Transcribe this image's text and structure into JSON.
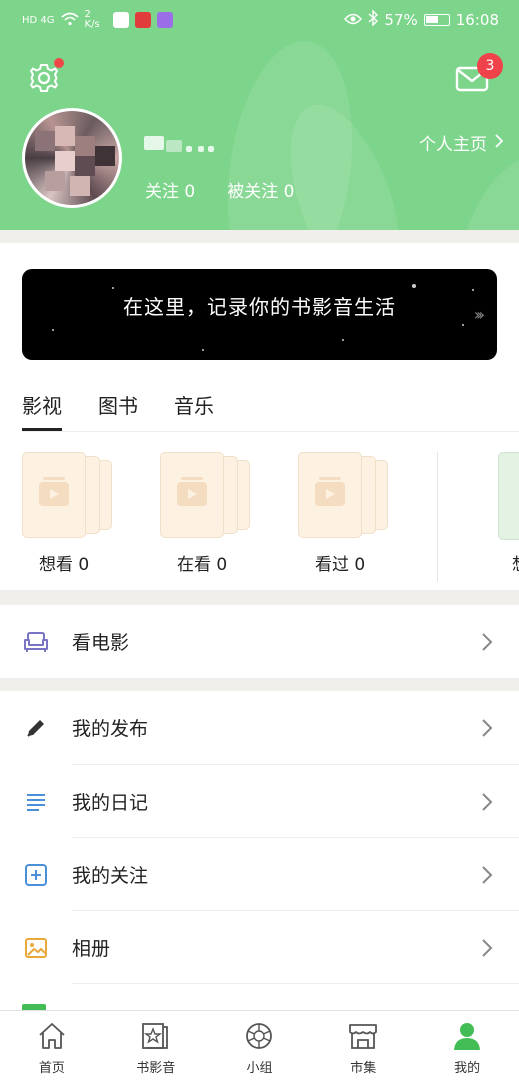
{
  "status_bar": {
    "network": "HD 4G",
    "speed": "2 K/s",
    "battery": "57%",
    "time": "16:08"
  },
  "header": {
    "mail_badge": "3",
    "follow_label": "关注 0",
    "followers_label": "被关注 0",
    "homepage_label": "个人主页"
  },
  "banner": {
    "text": "在这里，记录你的书影音生活"
  },
  "tabs": [
    {
      "label": "影视",
      "active": true
    },
    {
      "label": "图书",
      "active": false
    },
    {
      "label": "音乐",
      "active": false
    }
  ],
  "collections": [
    {
      "label": "想看 0"
    },
    {
      "label": "在看 0"
    },
    {
      "label": "看过 0"
    }
  ],
  "peek_label": "想",
  "movie_row": {
    "label": "看电影",
    "icon": "sofa-icon"
  },
  "menu": [
    {
      "label": "我的发布",
      "icon": "pencil-icon"
    },
    {
      "label": "我的日记",
      "icon": "lines-icon"
    },
    {
      "label": "我的关注",
      "icon": "plus-box-icon"
    },
    {
      "label": "相册",
      "icon": "photo-icon"
    }
  ],
  "bottom_nav": [
    {
      "label": "首页",
      "icon": "home-icon",
      "active": false
    },
    {
      "label": "书影音",
      "icon": "star-book-icon",
      "active": false
    },
    {
      "label": "小组",
      "icon": "group-icon",
      "active": false
    },
    {
      "label": "市集",
      "icon": "shop-icon",
      "active": false
    },
    {
      "label": "我的",
      "icon": "person-icon",
      "active": true
    }
  ],
  "colors": {
    "header_green": "#7dd48b",
    "active_green": "#42bd56",
    "badge_red": "#f0424a"
  }
}
